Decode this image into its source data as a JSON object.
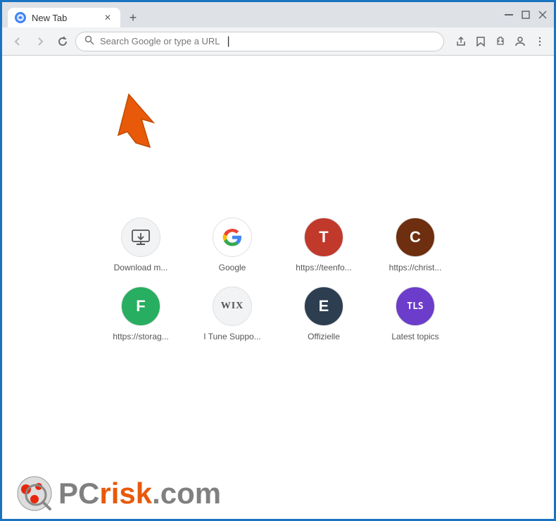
{
  "browser": {
    "tab_title": "New Tab",
    "new_tab_label": "+",
    "window_controls": {
      "minimize": "—",
      "maximize": "☐",
      "close": "✕"
    },
    "address_bar": {
      "placeholder": "Search Google or type a URL",
      "cursor": "|"
    },
    "nav": {
      "back": "←",
      "forward": "→",
      "reload": "↻"
    }
  },
  "shortcuts": [
    {
      "label": "Download m...",
      "icon_type": "monitor",
      "bg": "#f1f3f4",
      "text_color": "#555"
    },
    {
      "label": "Google",
      "icon_type": "google",
      "bg": "#fff",
      "text_color": "#555"
    },
    {
      "label": "https://teenfo...",
      "icon_type": "letter-T",
      "bg": "#c0392b",
      "text_color": "#fff"
    },
    {
      "label": "https://christ...",
      "icon_type": "letter-C",
      "bg": "#6d2f0f",
      "text_color": "#fff"
    },
    {
      "label": "https://storag...",
      "icon_type": "letter-F",
      "bg": "#27ae60",
      "text_color": "#fff"
    },
    {
      "label": "I Tune Suppo...",
      "icon_type": "wix",
      "bg": "#f1f3f4",
      "text_color": "#555"
    },
    {
      "label": "Offizielle",
      "icon_type": "letter-E",
      "bg": "#2c3e50",
      "text_color": "#fff"
    },
    {
      "label": "Latest topics",
      "icon_type": "tls",
      "bg": "#6c3dcb",
      "text_color": "#fff"
    }
  ],
  "pcrisk": {
    "domain": "risk.com",
    "brand": "PC"
  }
}
